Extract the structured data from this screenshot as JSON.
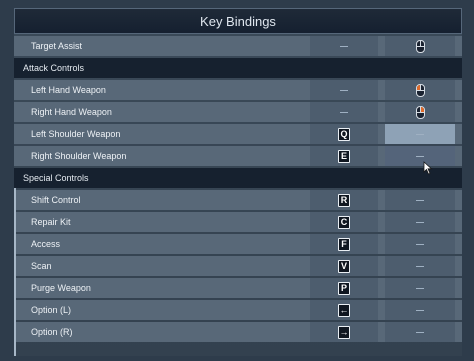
{
  "title": "Key Bindings",
  "rows": [
    {
      "type": "binding",
      "label": "Target Assist",
      "primary": "—",
      "secondary": "mouse-middle-icon"
    },
    {
      "type": "section",
      "label": "Attack Controls"
    },
    {
      "type": "binding",
      "label": "Left Hand Weapon",
      "primary": "—",
      "secondary": "mouse-left-icon"
    },
    {
      "type": "binding",
      "label": "Right Hand Weapon",
      "primary": "—",
      "secondary": "mouse-right-icon"
    },
    {
      "type": "binding",
      "label": "Left Shoulder Weapon",
      "primary": "Q",
      "secondary": "—"
    },
    {
      "type": "binding",
      "label": "Right Shoulder Weapon",
      "primary": "E",
      "secondary": "—"
    },
    {
      "type": "section",
      "label": "Special Controls"
    },
    {
      "type": "binding",
      "label": "Shift Control",
      "primary": "R",
      "secondary": "—"
    },
    {
      "type": "binding",
      "label": "Repair Kit",
      "primary": "C",
      "secondary": "—"
    },
    {
      "type": "binding",
      "label": "Access",
      "primary": "F",
      "secondary": "—"
    },
    {
      "type": "binding",
      "label": "Scan",
      "primary": "V",
      "secondary": "—"
    },
    {
      "type": "binding",
      "label": "Purge Weapon",
      "primary": "P",
      "secondary": "—"
    },
    {
      "type": "binding",
      "label": "Option (L)",
      "primary": "←",
      "secondary": "—"
    },
    {
      "type": "binding",
      "label": "Option (R)",
      "primary": "→",
      "secondary": "—"
    }
  ]
}
